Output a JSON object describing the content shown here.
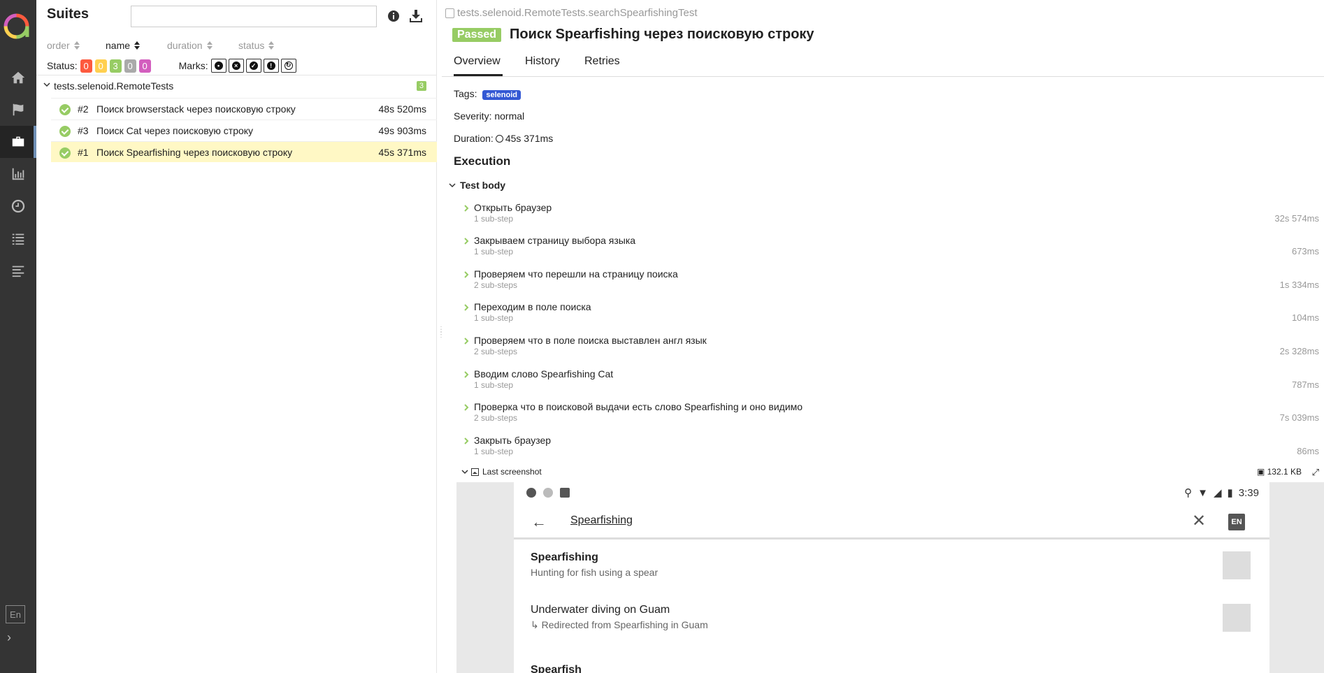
{
  "left_panel": {
    "title": "Suites",
    "search_value": "",
    "sort": {
      "order": "order",
      "name": "name",
      "duration": "duration",
      "status": "status"
    },
    "status_label": "Status:",
    "status_counts": [
      {
        "name": "failed",
        "value": "0",
        "color": "#fd5a3e"
      },
      {
        "name": "broken",
        "value": "0",
        "color": "#ffd050"
      },
      {
        "name": "passed",
        "value": "3",
        "color": "#97cc64"
      },
      {
        "name": "skipped",
        "value": "0",
        "color": "#aaaaaa"
      },
      {
        "name": "unknown",
        "value": "0",
        "color": "#d35ebe"
      }
    ],
    "marks_label": "Marks:",
    "group": {
      "name": "tests.selenoid.RemoteTests",
      "count": "3"
    },
    "tests": [
      {
        "num": "#2",
        "name": "Поиск browserstack через поисковую строку",
        "duration": "48s 520ms"
      },
      {
        "num": "#3",
        "name": "Поиск Cat через поисковую строку",
        "duration": "49s 903ms"
      },
      {
        "num": "#1",
        "name": "Поиск Spearfishing через поисковую строку",
        "duration": "45s 371ms"
      }
    ]
  },
  "nav": {
    "lang": "En"
  },
  "right_panel": {
    "full_name": "tests.selenoid.RemoteTests.searchSpearfishingTest",
    "status": "Passed",
    "title": "Поиск Spearfishing через поисковую строку",
    "tabs": [
      "Overview",
      "History",
      "Retries"
    ],
    "tags_label": "Tags:",
    "tag": "selenoid",
    "severity": "Severity: normal",
    "duration_label": "Duration:",
    "duration": "45s 371ms",
    "execution": "Execution",
    "test_body": "Test body",
    "steps": [
      {
        "name": "Открыть браузер",
        "sub": "1 sub-step",
        "duration": "32s 574ms"
      },
      {
        "name": "Закрываем страницу выбора языка",
        "sub": "1 sub-step",
        "duration": "673ms"
      },
      {
        "name": "Проверяем что перешли на страницу поиска",
        "sub": "2 sub-steps",
        "duration": "1s 334ms"
      },
      {
        "name": "Переходим в поле поиска",
        "sub": "1 sub-step",
        "duration": "104ms"
      },
      {
        "name": "Проверяем что в поле поиска выставлен англ язык",
        "sub": "2 sub-steps",
        "duration": "2s 328ms"
      },
      {
        "name": "Вводим слово Spearfishing Cat",
        "sub": "1 sub-step",
        "duration": "787ms"
      },
      {
        "name": "Проверка что в поисковой выдачи есть слово Spearfishing и оно видимо",
        "sub": "2 sub-steps",
        "duration": "7s 039ms"
      },
      {
        "name": "Закрыть браузер",
        "sub": "1 sub-step",
        "duration": "86ms"
      }
    ],
    "attachment": {
      "name": "Last screenshot",
      "size": "132.1 KB"
    }
  },
  "screenshot": {
    "time": "3:39",
    "query": "Spearfishing",
    "lang": "EN",
    "results": [
      {
        "title": "Spearfishing",
        "subtitle": "Hunting for fish using a spear"
      },
      {
        "title": "Underwater diving on Guam",
        "subtitle": "↳ Redirected from Spearfishing in Guam"
      },
      {
        "title": "Spearfish",
        "subtitle": ""
      }
    ]
  }
}
